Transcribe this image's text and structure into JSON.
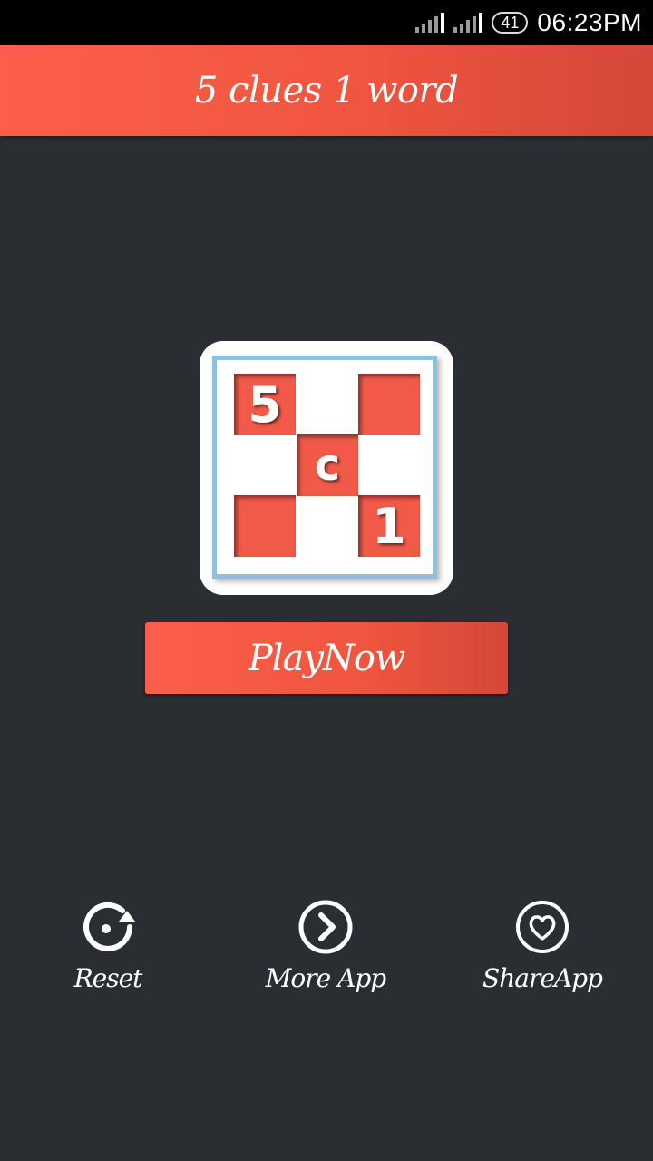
{
  "status_bar": {
    "battery": "41",
    "time": "06:23PM"
  },
  "header": {
    "title": "5 clues 1 word"
  },
  "logo": {
    "cell_top_left": "5",
    "cell_center": "c",
    "cell_bottom_right": "1"
  },
  "play_button": {
    "label": "PlayNow"
  },
  "actions": [
    {
      "label": "Reset",
      "icon": "reset-icon"
    },
    {
      "label": "More App",
      "icon": "chevron-right-circle-icon"
    },
    {
      "label": "ShareApp",
      "icon": "heart-circle-icon"
    }
  ],
  "colors": {
    "accent": "#f0553f",
    "background": "#2a2d32",
    "logo_border": "#8dc0dd"
  }
}
